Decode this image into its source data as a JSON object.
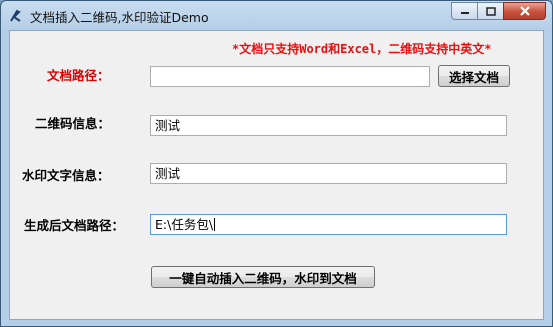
{
  "window": {
    "title": "文档插入二维码,水印验证Demo",
    "controls": [
      "minimize",
      "maximize",
      "close"
    ]
  },
  "notice": "*文档只支持Word和Excel，二维码支持中英文*",
  "form": {
    "doc_path": {
      "label": "文档路径：",
      "value": ""
    },
    "browse_button": "选择文档",
    "qr_info": {
      "label": "二维码信息：",
      "value": "测试"
    },
    "watermark_text": {
      "label": "水印文字信息：",
      "value": "测试"
    },
    "output_path": {
      "label": "生成后文档路径：",
      "value": "E:\\任务包\\"
    },
    "submit_button": "一键自动插入二维码，水印到文档"
  },
  "colors": {
    "notice": "#e81010",
    "required_label": "#e00000",
    "client_bg": "#f0f0f0"
  }
}
